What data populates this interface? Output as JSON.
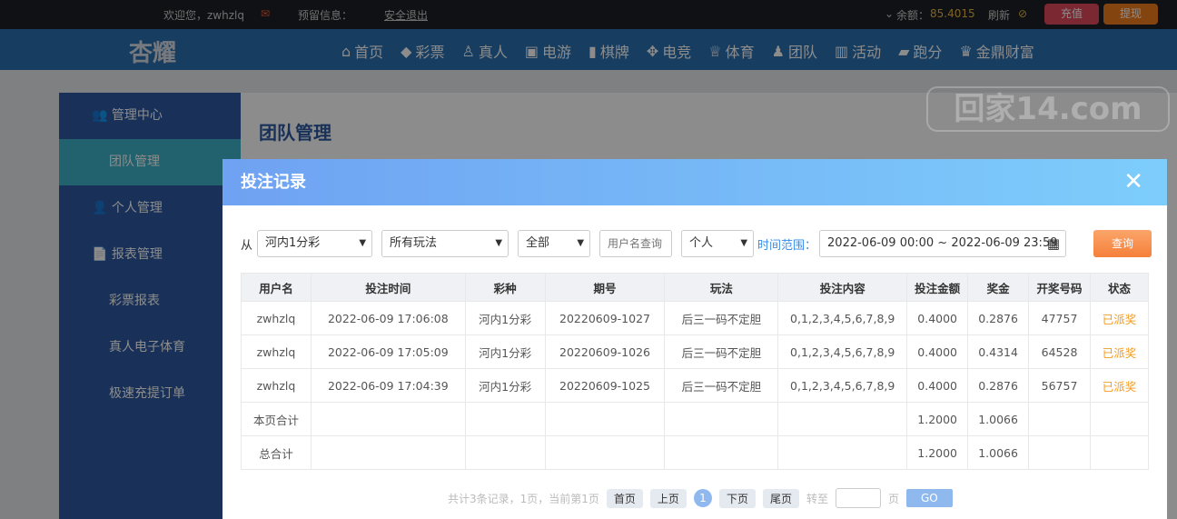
{
  "topbar": {
    "welcome": "欢迎您，zwhzlq",
    "reserved": "预留信息：",
    "logout": "安全退出",
    "balance_label": "余额：",
    "balance": "85.4015",
    "refresh": "刷新",
    "deposit": "充值",
    "withdraw": "提现"
  },
  "logo": "杏耀",
  "nav": [
    "首页",
    "彩票",
    "真人",
    "电游",
    "棋牌",
    "电竞",
    "体育",
    "团队",
    "活动",
    "跑分",
    "金鼎财富"
  ],
  "watermark": "回家14.com",
  "sidebar": {
    "center": "管理中心",
    "team_mgmt": "团队管理",
    "personal": "个人管理",
    "reports": "报表管理",
    "lottery_report": "彩票报表",
    "live_report": "真人电子体育",
    "fast_order": "极速充提订单"
  },
  "main_title": "团队管理",
  "modal": {
    "title": "投注记录",
    "from": "从",
    "lottery": "河内1分彩",
    "play": "所有玩法",
    "scope": "全部",
    "username_placeholder": "用户名查询",
    "type": "个人",
    "range_label": "时间范围：",
    "range": "2022-06-09 00:00 ~ 2022-06-09 23:59",
    "query": "查询"
  },
  "table": {
    "headers": [
      "用户名",
      "投注时间",
      "彩种",
      "期号",
      "玩法",
      "投注内容",
      "投注金额",
      "奖金",
      "开奖号码",
      "状态"
    ],
    "rows": [
      [
        "zwhzlq",
        "2022-06-09 17:06:08",
        "河内1分彩",
        "20220609-1027",
        "后三一码不定胆",
        "0,1,2,3,4,5,6,7,8,9",
        "0.4000",
        "0.2876",
        "47757",
        "已派奖"
      ],
      [
        "zwhzlq",
        "2022-06-09 17:05:09",
        "河内1分彩",
        "20220609-1026",
        "后三一码不定胆",
        "0,1,2,3,4,5,6,7,8,9",
        "0.4000",
        "0.4314",
        "64528",
        "已派奖"
      ],
      [
        "zwhzlq",
        "2022-06-09 17:04:39",
        "河内1分彩",
        "20220609-1025",
        "后三一码不定胆",
        "0,1,2,3,4,5,6,7,8,9",
        "0.4000",
        "0.2876",
        "56757",
        "已派奖"
      ]
    ],
    "page_total": {
      "label": "本页合计",
      "amount": "1.2000",
      "bonus": "1.0066"
    },
    "grand_total": {
      "label": "总合计",
      "amount": "1.2000",
      "bonus": "1.0066"
    }
  },
  "pager": {
    "summary": "共计3条记录，1页，当前第1页",
    "first": "首页",
    "prev": "上页",
    "current": "1",
    "next": "下页",
    "last": "尾页",
    "goto": "转至",
    "page": "页",
    "go": "GO"
  }
}
